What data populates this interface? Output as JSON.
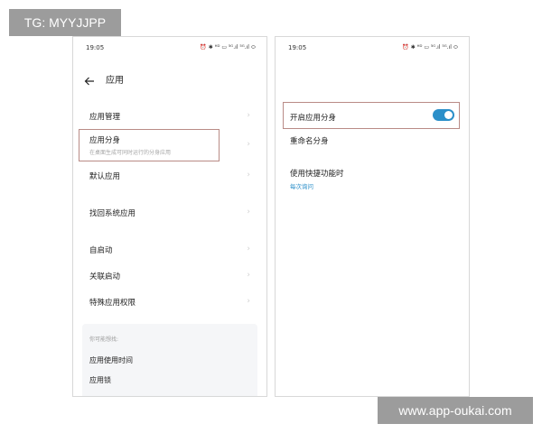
{
  "watermarks": {
    "top_left": "TG: MYYJJPP",
    "bottom_right": "www.app-oukai.com"
  },
  "status_bar": {
    "time": "19:05",
    "icons": "⏰ ✱ ᴴᴰ ▭ ⁵ᴳ.ıl ⁵ᴳ.ıl ⬭"
  },
  "left_screen": {
    "title": "应用",
    "items": [
      {
        "label": "应用管理",
        "sub": ""
      },
      {
        "label": "应用分身",
        "sub": "在桌面生成可同时运行的分身应用"
      },
      {
        "label": "默认应用",
        "sub": ""
      },
      {
        "label": "找回系统应用",
        "sub": ""
      },
      {
        "label": "自启动",
        "sub": ""
      },
      {
        "label": "关联启动",
        "sub": ""
      },
      {
        "label": "特殊应用权限",
        "sub": ""
      }
    ],
    "suggest": {
      "title": "你可能想找:",
      "items": [
        "应用使用时间",
        "应用锁"
      ]
    }
  },
  "right_screen": {
    "toggle_label": "开启应用分身",
    "toggle_state": "on",
    "rename_label": "重命名分身",
    "shortcut_label": "使用快捷功能时",
    "shortcut_value": "每次询问"
  },
  "colors": {
    "accent": "#2b8fc9",
    "highlight_border": "#b98b86",
    "watermark_bg": "#9c9c9c"
  }
}
